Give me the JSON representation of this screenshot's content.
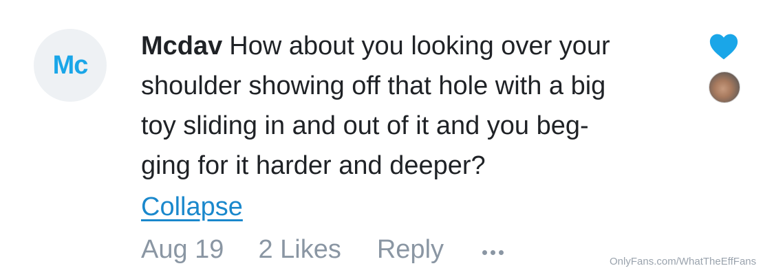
{
  "comment": {
    "avatar_initials": "Mc",
    "username": "Mcdav",
    "text_lines": [
      "How about you looking over your",
      "shoulder showing off that hole with a big",
      "toy sliding in and out of it and you beg-",
      "ging for it harder and deeper?"
    ],
    "collapse_label": "Collapse",
    "date": "Aug 19",
    "likes": "2 Likes",
    "reply_label": "Reply",
    "more_icon": "more-dots-icon",
    "liked_icon": "heart-icon",
    "liked_color": "#1aa6e8"
  },
  "watermark": "OnlyFans.com/WhatTheEffFans"
}
